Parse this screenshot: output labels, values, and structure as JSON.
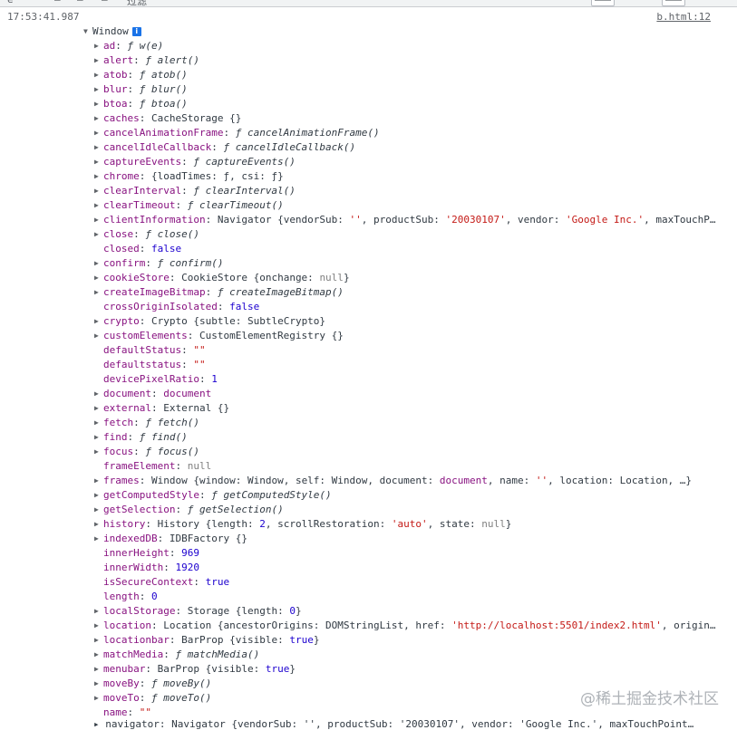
{
  "topbar": {
    "fragments": [
      "e",
      "—",
      "—",
      "—",
      "过滤"
    ],
    "right_box_1": "———",
    "right_box_2": "———"
  },
  "console": {
    "timestamp": "17:53:41.987",
    "source_link": "b.html:12",
    "root_label": "Window",
    "info_badge": "i",
    "properties": [
      {
        "key": "ad",
        "expandable": true,
        "parts": [
          {
            "t": "fn",
            "v": "ƒ w(e)"
          }
        ]
      },
      {
        "key": "alert",
        "expandable": true,
        "parts": [
          {
            "t": "fn",
            "v": "ƒ alert()"
          }
        ]
      },
      {
        "key": "atob",
        "expandable": true,
        "parts": [
          {
            "t": "fn",
            "v": "ƒ atob()"
          }
        ]
      },
      {
        "key": "blur",
        "expandable": true,
        "parts": [
          {
            "t": "fn",
            "v": "ƒ blur()"
          }
        ]
      },
      {
        "key": "btoa",
        "expandable": true,
        "parts": [
          {
            "t": "fn",
            "v": "ƒ btoa()"
          }
        ]
      },
      {
        "key": "caches",
        "expandable": true,
        "parts": [
          {
            "t": "obj",
            "v": "CacheStorage {}"
          }
        ]
      },
      {
        "key": "cancelAnimationFrame",
        "expandable": true,
        "parts": [
          {
            "t": "fn",
            "v": "ƒ cancelAnimationFrame()"
          }
        ]
      },
      {
        "key": "cancelIdleCallback",
        "expandable": true,
        "parts": [
          {
            "t": "fn",
            "v": "ƒ cancelIdleCallback()"
          }
        ]
      },
      {
        "key": "captureEvents",
        "expandable": true,
        "parts": [
          {
            "t": "fn",
            "v": "ƒ captureEvents()"
          }
        ]
      },
      {
        "key": "chrome",
        "expandable": true,
        "parts": [
          {
            "t": "obj",
            "v": "{loadTimes: ƒ, csi: ƒ}"
          }
        ]
      },
      {
        "key": "clearInterval",
        "expandable": true,
        "parts": [
          {
            "t": "fn",
            "v": "ƒ clearInterval()"
          }
        ]
      },
      {
        "key": "clearTimeout",
        "expandable": true,
        "parts": [
          {
            "t": "fn",
            "v": "ƒ clearTimeout()"
          }
        ]
      },
      {
        "key": "clientInformation",
        "expandable": true,
        "parts": [
          {
            "t": "obj",
            "v": "Navigator {vendorSub: "
          },
          {
            "t": "str",
            "v": "''"
          },
          {
            "t": "obj",
            "v": ", productSub: "
          },
          {
            "t": "str",
            "v": "'20030107'"
          },
          {
            "t": "obj",
            "v": ", vendor: "
          },
          {
            "t": "str",
            "v": "'Google Inc.'"
          },
          {
            "t": "obj",
            "v": ", maxTouchP…"
          }
        ]
      },
      {
        "key": "close",
        "expandable": true,
        "parts": [
          {
            "t": "fn",
            "v": "ƒ close()"
          }
        ]
      },
      {
        "key": "closed",
        "expandable": false,
        "parts": [
          {
            "t": "bool",
            "v": "false"
          }
        ]
      },
      {
        "key": "confirm",
        "expandable": true,
        "parts": [
          {
            "t": "fn",
            "v": "ƒ confirm()"
          }
        ]
      },
      {
        "key": "cookieStore",
        "expandable": true,
        "parts": [
          {
            "t": "obj",
            "v": "CookieStore {onchange: "
          },
          {
            "t": "null",
            "v": "null"
          },
          {
            "t": "obj",
            "v": "}"
          }
        ]
      },
      {
        "key": "createImageBitmap",
        "expandable": true,
        "parts": [
          {
            "t": "fn",
            "v": "ƒ createImageBitmap()"
          }
        ]
      },
      {
        "key": "crossOriginIsolated",
        "expandable": false,
        "parts": [
          {
            "t": "bool",
            "v": "false"
          }
        ]
      },
      {
        "key": "crypto",
        "expandable": true,
        "parts": [
          {
            "t": "obj",
            "v": "Crypto {subtle: SubtleCrypto}"
          }
        ]
      },
      {
        "key": "customElements",
        "expandable": true,
        "parts": [
          {
            "t": "obj",
            "v": "CustomElementRegistry {}"
          }
        ]
      },
      {
        "key": "defaultStatus",
        "expandable": false,
        "parts": [
          {
            "t": "str",
            "v": "\"\""
          }
        ]
      },
      {
        "key": "defaultstatus",
        "expandable": false,
        "parts": [
          {
            "t": "str",
            "v": "\"\""
          }
        ]
      },
      {
        "key": "devicePixelRatio",
        "expandable": false,
        "parts": [
          {
            "t": "num",
            "v": "1"
          }
        ]
      },
      {
        "key": "document",
        "expandable": true,
        "parts": [
          {
            "t": "key",
            "v": "document"
          }
        ]
      },
      {
        "key": "external",
        "expandable": true,
        "parts": [
          {
            "t": "obj",
            "v": "External {}"
          }
        ]
      },
      {
        "key": "fetch",
        "expandable": true,
        "parts": [
          {
            "t": "fn",
            "v": "ƒ fetch()"
          }
        ]
      },
      {
        "key": "find",
        "expandable": true,
        "parts": [
          {
            "t": "fn",
            "v": "ƒ find()"
          }
        ]
      },
      {
        "key": "focus",
        "expandable": true,
        "parts": [
          {
            "t": "fn",
            "v": "ƒ focus()"
          }
        ]
      },
      {
        "key": "frameElement",
        "expandable": false,
        "parts": [
          {
            "t": "null",
            "v": "null"
          }
        ]
      },
      {
        "key": "frames",
        "expandable": true,
        "parts": [
          {
            "t": "obj",
            "v": "Window {window: Window, self: Window, document: "
          },
          {
            "t": "key",
            "v": "document"
          },
          {
            "t": "obj",
            "v": ", name: "
          },
          {
            "t": "str",
            "v": "''"
          },
          {
            "t": "obj",
            "v": ", location: Location, …}"
          }
        ]
      },
      {
        "key": "getComputedStyle",
        "expandable": true,
        "parts": [
          {
            "t": "fn",
            "v": "ƒ getComputedStyle()"
          }
        ]
      },
      {
        "key": "getSelection",
        "expandable": true,
        "parts": [
          {
            "t": "fn",
            "v": "ƒ getSelection()"
          }
        ]
      },
      {
        "key": "history",
        "expandable": true,
        "parts": [
          {
            "t": "obj",
            "v": "History {length: "
          },
          {
            "t": "num",
            "v": "2"
          },
          {
            "t": "obj",
            "v": ", scrollRestoration: "
          },
          {
            "t": "str",
            "v": "'auto'"
          },
          {
            "t": "obj",
            "v": ", state: "
          },
          {
            "t": "null",
            "v": "null"
          },
          {
            "t": "obj",
            "v": "}"
          }
        ]
      },
      {
        "key": "indexedDB",
        "expandable": true,
        "parts": [
          {
            "t": "obj",
            "v": "IDBFactory {}"
          }
        ]
      },
      {
        "key": "innerHeight",
        "expandable": false,
        "parts": [
          {
            "t": "num",
            "v": "969"
          }
        ]
      },
      {
        "key": "innerWidth",
        "expandable": false,
        "parts": [
          {
            "t": "num",
            "v": "1920"
          }
        ]
      },
      {
        "key": "isSecureContext",
        "expandable": false,
        "parts": [
          {
            "t": "bool",
            "v": "true"
          }
        ]
      },
      {
        "key": "length",
        "expandable": false,
        "parts": [
          {
            "t": "num",
            "v": "0"
          }
        ]
      },
      {
        "key": "localStorage",
        "expandable": true,
        "parts": [
          {
            "t": "obj",
            "v": "Storage {length: "
          },
          {
            "t": "num",
            "v": "0"
          },
          {
            "t": "obj",
            "v": "}"
          }
        ]
      },
      {
        "key": "location",
        "expandable": true,
        "parts": [
          {
            "t": "obj",
            "v": "Location {ancestorOrigins: DOMStringList, href: "
          },
          {
            "t": "str",
            "v": "'http://localhost:5501/index2.html'"
          },
          {
            "t": "obj",
            "v": ", origin…"
          }
        ]
      },
      {
        "key": "locationbar",
        "expandable": true,
        "parts": [
          {
            "t": "obj",
            "v": "BarProp {visible: "
          },
          {
            "t": "bool",
            "v": "true"
          },
          {
            "t": "obj",
            "v": "}"
          }
        ]
      },
      {
        "key": "matchMedia",
        "expandable": true,
        "parts": [
          {
            "t": "fn",
            "v": "ƒ matchMedia()"
          }
        ]
      },
      {
        "key": "menubar",
        "expandable": true,
        "parts": [
          {
            "t": "obj",
            "v": "BarProp {visible: "
          },
          {
            "t": "bool",
            "v": "true"
          },
          {
            "t": "obj",
            "v": "}"
          }
        ]
      },
      {
        "key": "moveBy",
        "expandable": true,
        "parts": [
          {
            "t": "fn",
            "v": "ƒ moveBy()"
          }
        ]
      },
      {
        "key": "moveTo",
        "expandable": true,
        "parts": [
          {
            "t": "fn",
            "v": "ƒ moveTo()"
          }
        ]
      },
      {
        "key": "name",
        "expandable": false,
        "parts": [
          {
            "t": "str",
            "v": "\"\""
          }
        ]
      }
    ],
    "cutoff_line": "▸ navigator: Navigator {vendorSub: '', productSub: '20030107', vendor: 'Google Inc.', maxTouchPoint…"
  },
  "watermark": "@稀土掘金技术社区",
  "colors": {
    "key": "#881280",
    "string": "#c41a16",
    "number": "#1c00cf",
    "null": "#808080",
    "info": "#1a73e8"
  }
}
